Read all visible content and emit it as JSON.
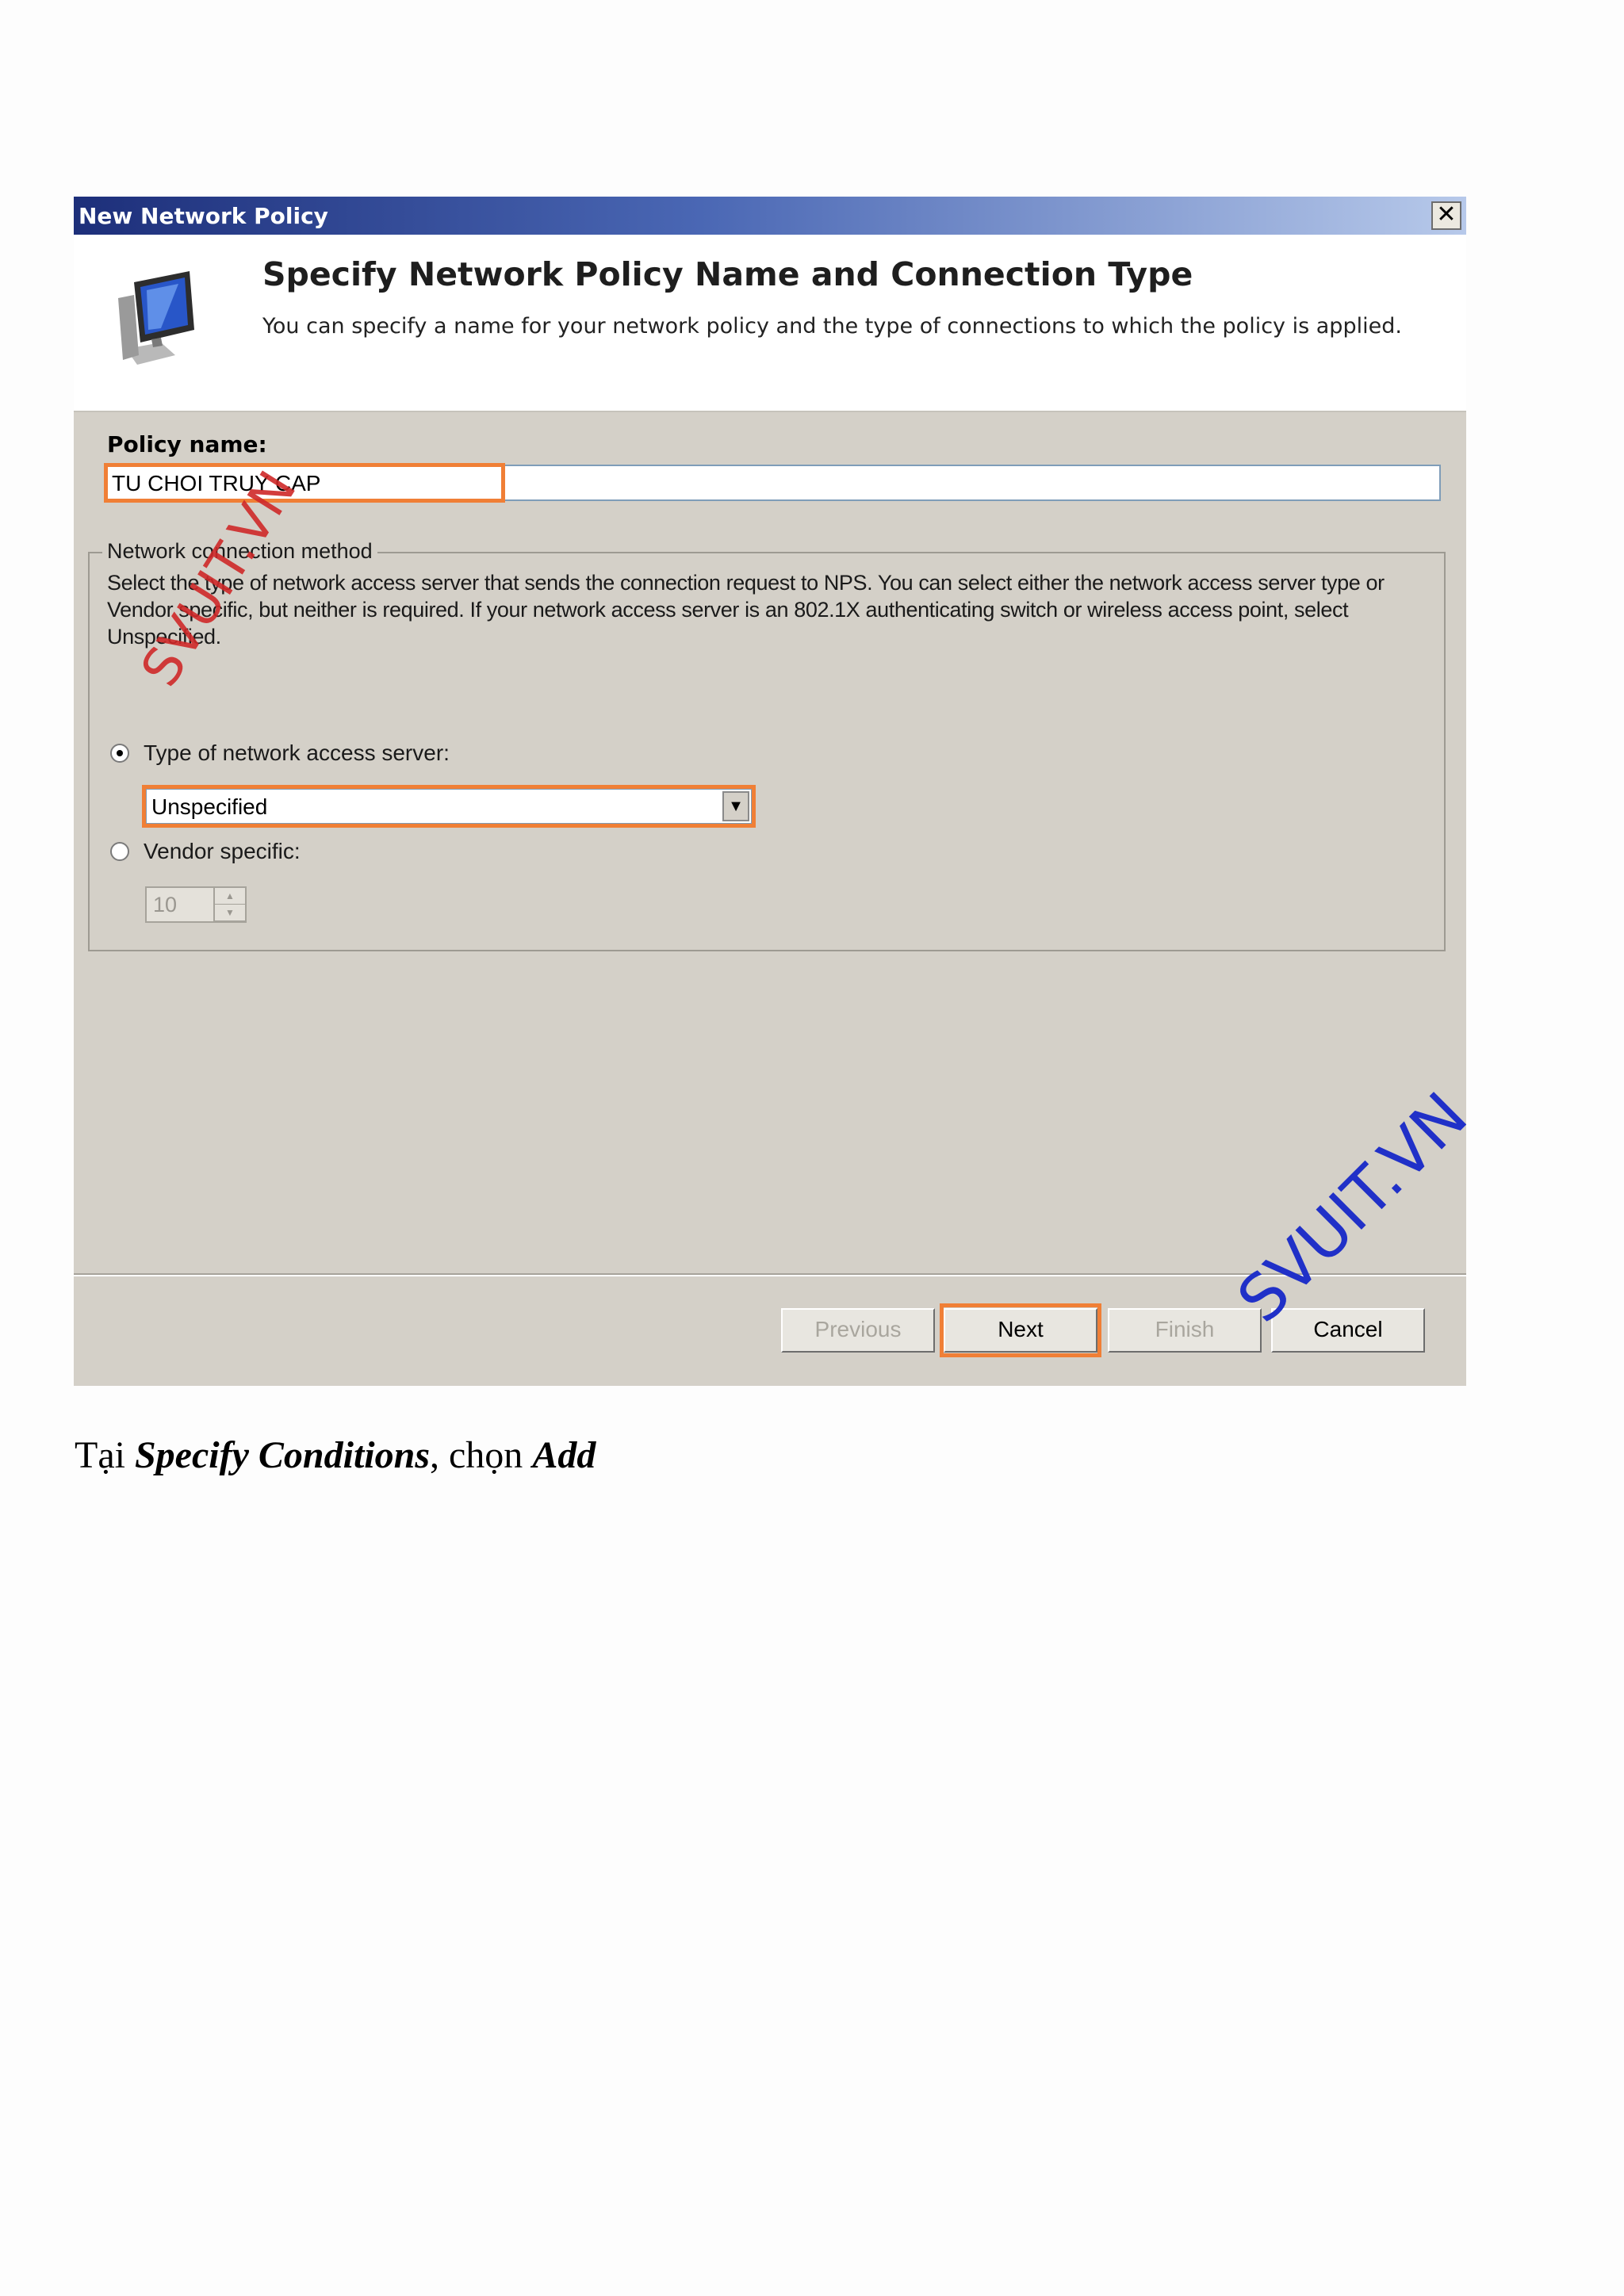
{
  "dialog": {
    "title": "New Network Policy",
    "close_glyph": "✕",
    "header": {
      "title": "Specify Network Policy Name and Connection Type",
      "description": "You can specify a name for your network policy and the type of connections to which the policy is applied."
    },
    "policy_name": {
      "label": "Policy name:",
      "value": "TU CHOI TRUY CAP"
    },
    "connection_method": {
      "legend": "Network connection method",
      "description": "Select the type of network access server that sends the connection request to NPS. You can select either the network access server type or Vendor specific, but neither is required.  If your network access server is an 802.1X authenticating switch or wireless access point, select Unspecified.",
      "type_radio_label": "Type of network access server:",
      "type_radio_selected": true,
      "type_select_value": "Unspecified",
      "vendor_radio_label": "Vendor specific:",
      "vendor_radio_selected": false,
      "vendor_value": "10"
    },
    "buttons": {
      "previous": "Previous",
      "next": "Next",
      "finish": "Finish",
      "cancel": "Cancel"
    },
    "highlight_color": "#f07f36"
  },
  "watermarks": {
    "red": "SVUIT.VN",
    "blue": "SVUIT.VN"
  },
  "caption": {
    "prefix": "Tại ",
    "term1": "Specify Conditions",
    "middle": ", chọn ",
    "term2": "Add"
  }
}
